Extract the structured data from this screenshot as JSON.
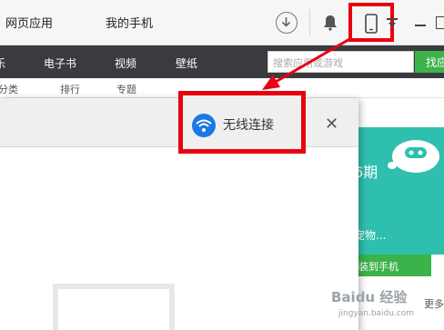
{
  "titlebar": {
    "tabs": [
      "网页应用",
      "我的手机"
    ]
  },
  "navbar": {
    "items": [
      "乐",
      "电子书",
      "视频",
      "壁纸"
    ],
    "search_placeholder": "搜索应用或游戏",
    "search_button": "找应"
  },
  "subrow": {
    "items": [
      "分类",
      "排行",
      "专题"
    ]
  },
  "promo": {
    "issue": "6期",
    "title": "宠物...",
    "button": "装到手机",
    "more": "更多"
  },
  "dialog": {
    "wifi_label": "无线连接",
    "close": "✕"
  },
  "watermark": {
    "brand": "Baidu 经验",
    "url": "jingyan.baidu.com"
  },
  "colors": {
    "highlight": "#e8000f",
    "navbar": "#3a3b3e",
    "accent_green": "#3cb34a",
    "wifi_blue": "#1c79e3",
    "promo_teal": "#2fbfae"
  },
  "icons": [
    "download-icon",
    "bell-icon",
    "phone-icon",
    "menu-icon",
    "minimize-icon",
    "maximize-icon",
    "wifi-icon",
    "close-icon",
    "robot-mascot-icon"
  ]
}
